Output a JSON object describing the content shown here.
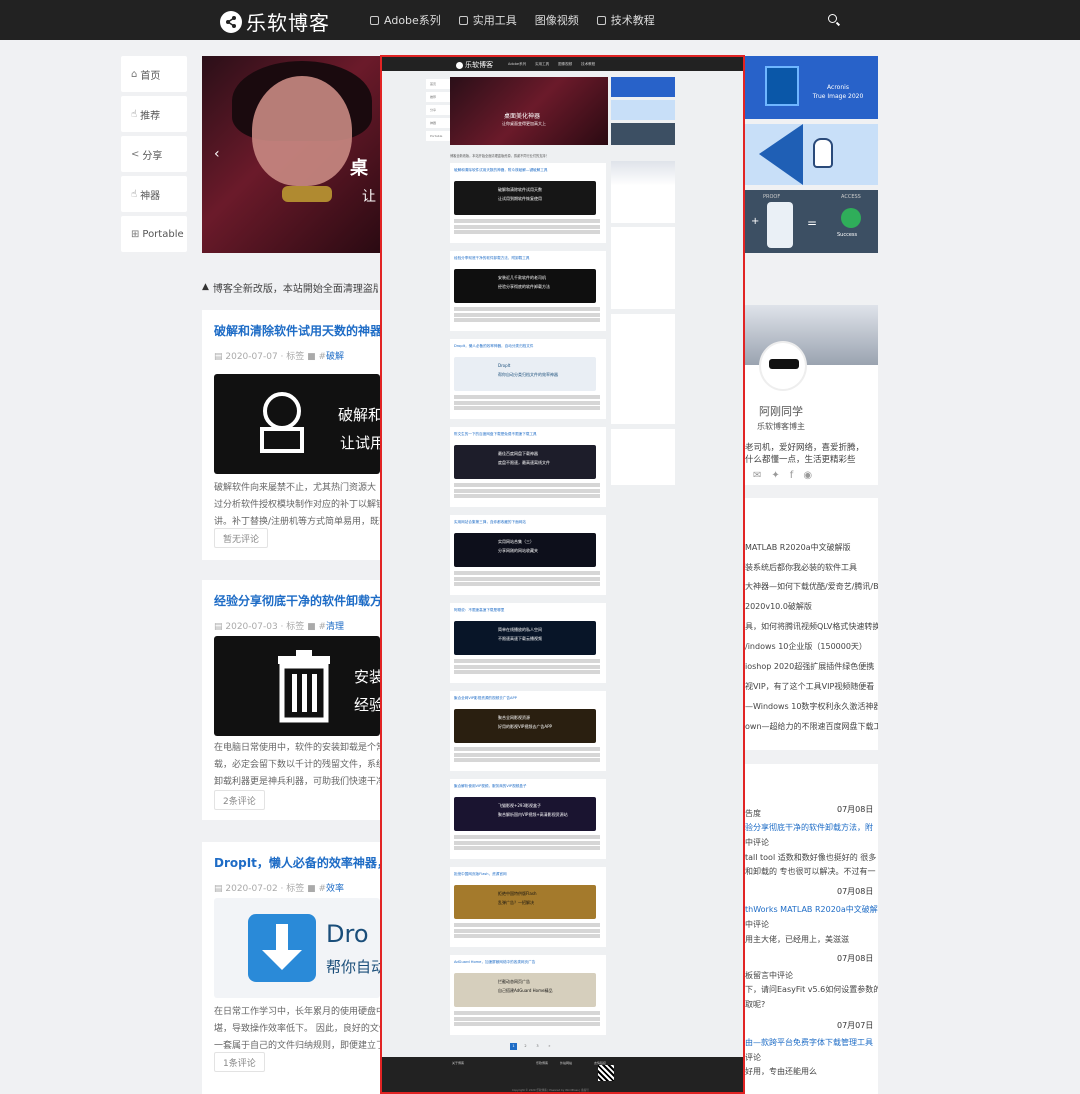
{
  "site": {
    "logo_text": "乐软博客"
  },
  "nav": [
    {
      "label": "Adobe系列",
      "icon": "adobe-icon"
    },
    {
      "label": "实用工具",
      "icon": "tools-icon"
    },
    {
      "label": "图像视频",
      "icon": ""
    },
    {
      "label": "技术教程",
      "icon": "book-icon"
    }
  ],
  "left_menu": [
    {
      "label": "首页",
      "icon": "home-icon"
    },
    {
      "label": "推荐",
      "icon": "thumb-icon"
    },
    {
      "label": "分享",
      "icon": "share-icon"
    },
    {
      "label": "神器",
      "icon": "thumb-icon"
    },
    {
      "label": "Portable",
      "icon": "grid-icon"
    }
  ],
  "hero": {
    "title_partial": "桌",
    "subtitle_partial": "让",
    "inset_title": "桌面美化神器",
    "inset_subtitle": "让你桌面变得更加高大上"
  },
  "promos": [
    {
      "title": "Acronis",
      "subtitle": "True Image 2020"
    },
    {
      "title": "",
      "subtitle": ""
    },
    {
      "label_left": "PROOF",
      "label_right": "ACCESS",
      "result": "Success"
    }
  ],
  "notice": {
    "text": "博客全新改版，本站開始全面清理盗版资源"
  },
  "posts": [
    {
      "title": "破解和清除软件试用天数的神器，",
      "date": "2020-07-07",
      "tag": "破解",
      "cap1": "破解和",
      "cap2": "让试用",
      "excerpt1": "破解软件向来屡禁不止，尤其热门资源大",
      "excerpt2": "过分析软件授权模块制作对应的补丁以解锁",
      "excerpt3": "讲。补丁替换/注册机等方式简单易用，既安",
      "comments": "暂无评论"
    },
    {
      "title": "经验分享彻底干净的软件卸载方法",
      "date": "2020-07-03",
      "tag": "清理",
      "cap1": "安装",
      "cap2": "经验",
      "excerpt1": "在电脑日常使用中，软件的安装卸载是个常",
      "excerpt2": "载，必定会留下数以千计的残留文件，系统",
      "excerpt3": "卸载利器更是神兵利器，可助我们快速干净",
      "comments": "2条评论"
    },
    {
      "title": "DropIt，懒人必备的效率神器，自",
      "date": "2020-07-02",
      "tag": "效率",
      "cap1": "Dro",
      "cap2": "帮你自动",
      "excerpt1": "在日常工作学习中，长年累月的使用硬盘中",
      "excerpt2": "堪，导致操作效率低下。 因此，良好的文件",
      "excerpt3": "一套属于自己的文件归纳规则，即便建立了",
      "comments": "1条评论"
    }
  ],
  "profile": {
    "name": "阿刚同学",
    "role": "乐软博客博主",
    "desc1": "老司机，爱好网络，喜爱折腾，",
    "desc2": "什么都懂一点，生活更精彩些"
  },
  "recent_list": [
    "MATLAB R2020a中文破解版",
    "装系统后都你我必装的软件工具",
    "大神器—如何下载优酷/爱奇艺/腾讯/B",
    "2020v10.0破解版",
    "具，如何将腾讯视频QLV格式快速转换",
    "/indows 10企业版（150000天）",
    "ioshop 2020超强扩展插件绿色便携",
    "视VIP，有了这个工具VIP视频随便看",
    "—Windows 10数字权利永久激活神器",
    "own—超给力的不限速百度网盘下载工具"
  ],
  "comments_list": [
    {
      "date": "07月08日",
      "l1": "告度",
      "l2": "验分享彻底干净的软件卸载方法，附",
      "l3": "中评论"
    },
    {
      "date": "",
      "l1": "tall tool 适数和数好像也挺好的 很多",
      "l2": "和卸载的 专也很可以解决。不过有一",
      "l3": ""
    },
    {
      "date": "07月08日",
      "l1": "thWorks MATLAB R2020a中文破解",
      "l2": "中评论",
      "l3": "用主大佬，已经用上，美滋滋"
    },
    {
      "date": "07月08日",
      "l1": "板留言中评论",
      "l2": "下，请问EasyFit v5.6如何设置参数的小",
      "l3": "取呢?"
    },
    {
      "date": "07月07日",
      "l1": "由—款跨平台免费字体下载管理工具",
      "l2": "评论",
      "l3": "好用，专由还能用么"
    }
  ],
  "inset": {
    "nav": [
      "Adobe系列",
      "实用工具",
      "图像视频",
      "技术教程"
    ],
    "menu": [
      "首页",
      "推荐",
      "分享",
      "神器",
      "Portable"
    ],
    "notice": "博客全新改版，本站开始全面清理盗版资源，感谢不同行业们的支持！",
    "posts": [
      {
        "title": "破解和清除软件试用天数的神器，附众核破解—键破解工具",
        "cap1": "破解和清除软件试用天数",
        "cap2": "让试用到期软件恢复使用",
        "color": "#161616"
      },
      {
        "title": "经验分享彻底干净的软件卸载方法，附卸载工具",
        "cap1": "安装近几千款软件的老司机",
        "cap2": "经验分享彻底的软件卸载方法",
        "color": "#0f0f0f"
      },
      {
        "title": "DropIt，懒人必备的效率神器，自动分类归档文件",
        "cap1": "DropIt",
        "cap2": "帮你自动分类归档文件的效率神器",
        "color": "#e9eef4"
      },
      {
        "title": "陈文生的一下的百度网盘下载是免费不限速下载工具",
        "cap1": "最佳百度网盘下载神器",
        "cap2": "度盘不限速，最高速离线文件",
        "color": "#1d1d2a"
      },
      {
        "title": "实用网站合集第三弹，连你都收藏的下面网站",
        "cap1": "实用网站合集（三）",
        "cap2": "分享网刚的网站收藏夹",
        "color": "#0d0f1b"
      },
      {
        "title": "阿刚说：不限速高速下载是哪里",
        "cap1": "简单在线播放的私人空间",
        "cap2": "不限速高速下载云播视频",
        "color": "#081528"
      },
      {
        "title": "聚合全网VIP影视资源的视频去广告APP",
        "cap1": "聚合全网影视资源",
        "cap2": "好用的影视VIP视频去广告APP",
        "color": "#2a1f10"
      },
      {
        "title": "聚合解析使用VIP视频，服务商的VIP视频盒子",
        "cap1": "飞猫影视+293影视盒子",
        "cap2": "聚合解析国内VIP视频+高清影视资源站",
        "color": "#1a1430"
      },
      {
        "title": "拒绝中国网页版Flash，资源官网",
        "cap1": "拒绝中国特供版Flash",
        "cap2": "乱弹广告？一招解决",
        "color": "#a47a2c"
      },
      {
        "title": "AdGuard Home，加速屏蔽网络中的各类网页广告",
        "cap1": "拦截动态网页广告",
        "cap2": "自己搭建AdGuard Home精品",
        "color": "#d6cfbd"
      }
    ],
    "page": [
      "1",
      "2",
      "3",
      "»"
    ],
    "footer": [
      "关于博客",
      "乐软博客",
      "外站网站",
      "友情链接"
    ],
    "copyright": "Copyright © 2020 乐软博客 | Powered by WordPress | 备案号"
  }
}
